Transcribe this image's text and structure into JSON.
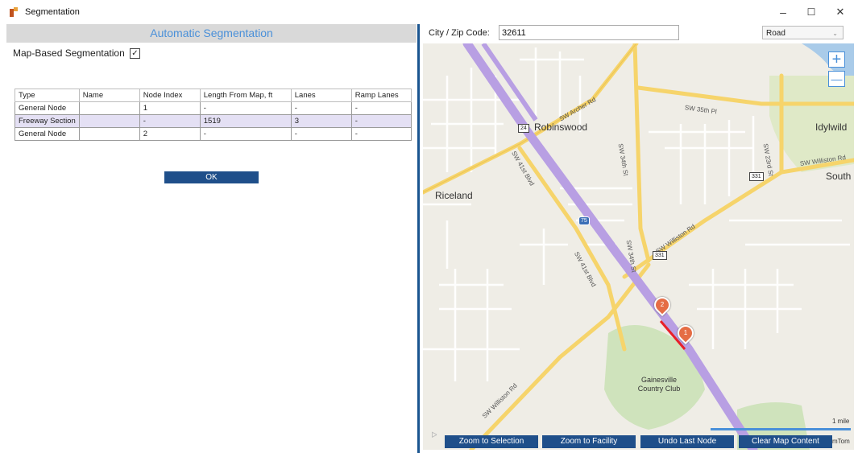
{
  "window": {
    "title": "Segmentation",
    "minimize_glyph": "–",
    "maximize_glyph": "☐",
    "close_glyph": "✕"
  },
  "left": {
    "header": "Automatic Segmentation",
    "map_based_label": "Map-Based Segmentation",
    "map_based_checked": true,
    "table": {
      "columns": [
        "Type",
        "Name",
        "Node Index",
        "Length From Map, ft",
        "Lanes",
        "Ramp Lanes"
      ],
      "rows": [
        {
          "type": "General Node",
          "name": "",
          "node_index": "1",
          "length": "-",
          "lanes": "-",
          "ramp_lanes": "-"
        },
        {
          "type": "Freeway Section",
          "name": "",
          "node_index": "-",
          "length": "1519",
          "lanes": "3",
          "ramp_lanes": "-"
        },
        {
          "type": "General Node",
          "name": "",
          "node_index": "2",
          "length": "-",
          "lanes": "-",
          "ramp_lanes": "-"
        }
      ],
      "selected_row": 1
    },
    "ok_label": "OK"
  },
  "right": {
    "city_label": "City / Zip Code:",
    "city_value": "32611",
    "map_type": "Road",
    "zoom_in": "+",
    "zoom_out": "—",
    "place_labels": {
      "robinswood": "Robinswood",
      "idylwild": "Idylwild",
      "riceland": "Riceland",
      "south": "South",
      "gainesville": "Gainesville Country Club"
    },
    "street_labels": {
      "archer": "SW Archer Rd",
      "sw35": "SW 35th Pl",
      "sw34": "SW 34th St",
      "sw34b": "SW 34th St",
      "sw23": "SW 23rd St",
      "williston1": "SW Williston Rd",
      "williston2": "SW Williston Rd",
      "williston3": "SW Williston Rd",
      "sw41a": "SW 41st Blvd",
      "sw41b": "SW 41st Blvd"
    },
    "shields": {
      "s24": "24",
      "s331a": "331",
      "s331b": "331",
      "i75": "75"
    },
    "markers": {
      "m1": "1",
      "m2": "2"
    },
    "scale_label": "1 mile",
    "attribution": "mTom",
    "buttons": {
      "zoom_selection": "Zoom to Selection",
      "zoom_facility": "Zoom to Facility",
      "undo": "Undo Last Node",
      "clear": "Clear Map Content"
    },
    "colors": {
      "highway": "#b89fe3",
      "arterial": "#f6d46b",
      "park": "#cfe3bc",
      "water": "#a9cbe9",
      "segment": "#e8202a",
      "marker": "#e56d45",
      "button": "#1f4f8a",
      "accent": "#4a90d9"
    }
  }
}
